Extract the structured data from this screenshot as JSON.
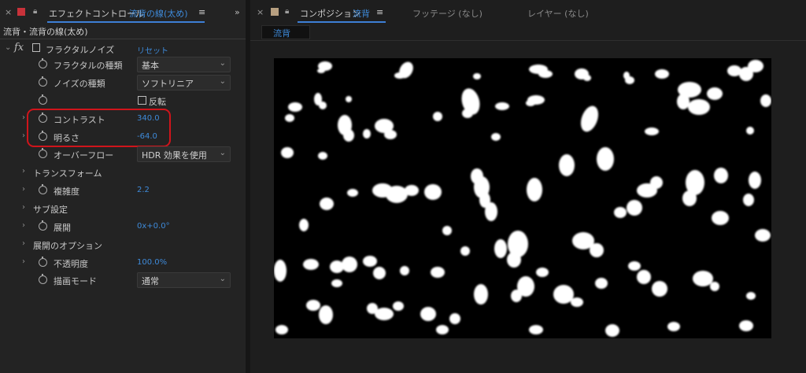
{
  "colors": {
    "accent": "#3e8ad9",
    "highlight": "#d0141b",
    "panel": "#232323"
  },
  "left_panel": {
    "tab_close": "×",
    "tab_title": "エフェクトコントロール",
    "tab_layer": "流背の線(太め)",
    "tab_menu": "≡",
    "overflow": "»",
    "breadcrumb": "流背・流背の線(太め)",
    "effect": {
      "fx_label": "fx",
      "name": "フラクタルノイズ",
      "reset": "リセット"
    },
    "props": {
      "fractal_type": {
        "label": "フラクタルの種類",
        "value": "基本"
      },
      "noise_type": {
        "label": "ノイズの種類",
        "value": "ソフトリニア"
      },
      "invert": {
        "label": "反転"
      },
      "contrast": {
        "label": "コントラスト",
        "value": "340.0"
      },
      "brightness": {
        "label": "明るさ",
        "value": "-64.0"
      },
      "overflow": {
        "label": "オーバーフロー",
        "value": "HDR 効果を使用"
      },
      "transform": {
        "label": "トランスフォーム"
      },
      "complexity": {
        "label": "複雑度",
        "value": "2.2"
      },
      "sub": {
        "label": "サブ設定"
      },
      "evolution": {
        "label": "展開",
        "value": "0x+0.0°"
      },
      "evolution_options": {
        "label": "展開のオプション"
      },
      "opacity": {
        "label": "不透明度",
        "value": "100.0%"
      },
      "blend": {
        "label": "描画モード",
        "value": "通常"
      }
    }
  },
  "right_panel": {
    "tab_close": "×",
    "tab_title": "コンポジション",
    "tab_comp": "流背",
    "tab_menu": "≡",
    "footage": "フッテージ (なし)",
    "layer": "レイヤー (なし)",
    "comp_tab": "流背"
  }
}
